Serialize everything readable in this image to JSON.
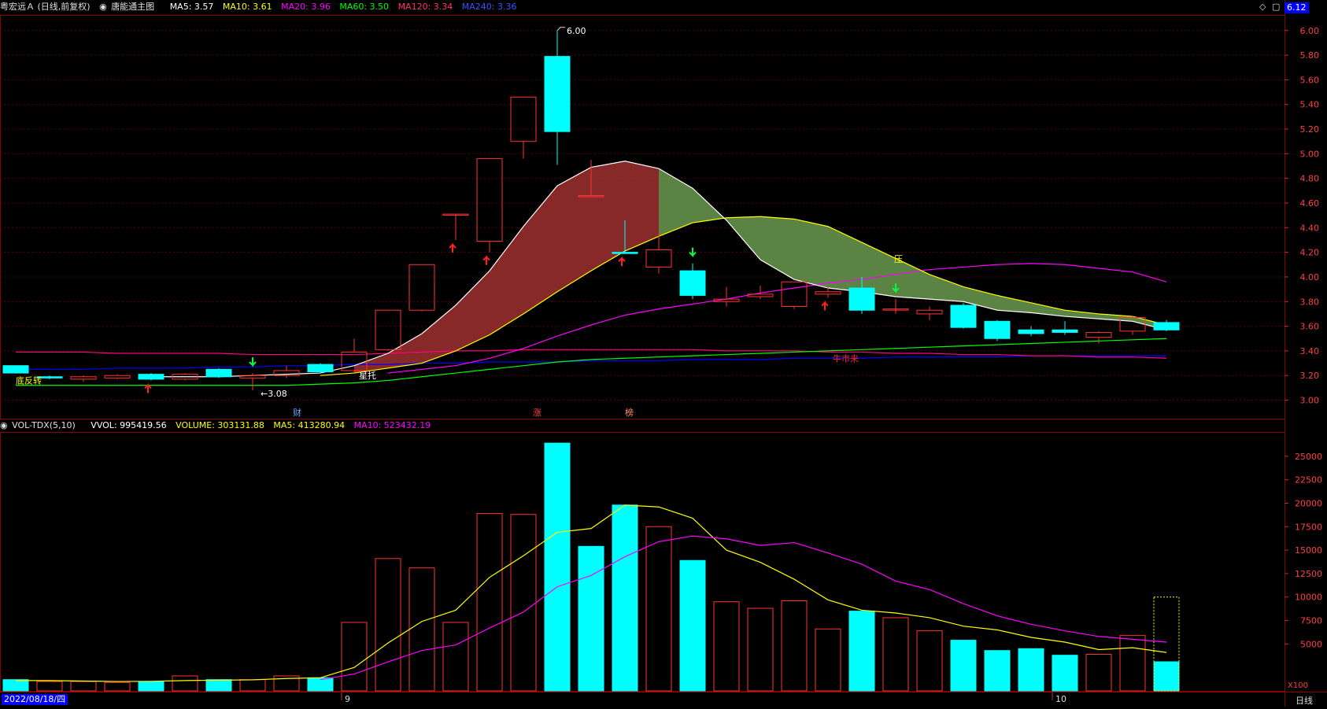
{
  "header": {
    "stock": "粤宏远Ａ (日线,前复权)",
    "indicator_name": "唐能通主图",
    "ma5": "MA5: 3.57",
    "ma10": "MA10: 3.61",
    "ma20": "MA20: 3.96",
    "ma60": "MA60: 3.50",
    "ma120": "MA120: 3.34",
    "ma240": "MA240: 3.36",
    "price_box": "6.12"
  },
  "volume_header": {
    "name": "VOL-TDX(5,10)",
    "vvol": "VVOL: 995419.56",
    "volume": "VOLUME: 303131.88",
    "ma5": "MA5: 413280.94",
    "ma10": "MA10: 523432.19"
  },
  "footer": {
    "date": "2022/08/18/四",
    "month_9": "9",
    "month_10": "10",
    "period": "日线",
    "unit": "X100"
  },
  "annotations": {
    "high_label": "6.00",
    "low_label": "←3.08",
    "xingtuo": "星托",
    "ya": "压",
    "niushi": "牛市来",
    "cai": "财",
    "zhang": "涨",
    "bang": "榜",
    "left_small": "底反转"
  },
  "colors": {
    "up": "#ff3333",
    "down": "#00ffff",
    "ma5": "#ffffff",
    "ma10": "#ffff00",
    "ma20": "#ff00ff",
    "ma60": "#00ff00",
    "ma120": "#ff0080",
    "ma240": "#0000ff",
    "bull_cloud": "#a03030",
    "bear_cloud": "#6b9b50"
  },
  "chart_data": [
    {
      "type": "candlestick",
      "title": "粤宏远Ａ (日线,前复权)",
      "ylim": [
        2.85,
        6.12
      ],
      "yticks": [
        3.0,
        3.2,
        3.4,
        3.6,
        3.8,
        4.0,
        4.2,
        4.4,
        4.6,
        4.8,
        5.0,
        5.2,
        5.4,
        5.6,
        5.8,
        6.0
      ],
      "candles": [
        {
          "o": 3.28,
          "h": 3.28,
          "l": 3.22,
          "c": 3.22
        },
        {
          "o": 3.19,
          "h": 3.2,
          "l": 3.17,
          "c": 3.18
        },
        {
          "o": 3.17,
          "h": 3.2,
          "l": 3.15,
          "c": 3.19
        },
        {
          "o": 3.18,
          "h": 3.21,
          "l": 3.17,
          "c": 3.2
        },
        {
          "o": 3.21,
          "h": 3.22,
          "l": 3.16,
          "c": 3.17
        },
        {
          "o": 3.17,
          "h": 3.22,
          "l": 3.16,
          "c": 3.21
        },
        {
          "o": 3.25,
          "h": 3.26,
          "l": 3.18,
          "c": 3.19
        },
        {
          "o": 3.18,
          "h": 3.22,
          "l": 3.08,
          "c": 3.2
        },
        {
          "o": 3.2,
          "h": 3.28,
          "l": 3.18,
          "c": 3.24
        },
        {
          "o": 3.29,
          "h": 3.3,
          "l": 3.22,
          "c": 3.23
        },
        {
          "o": 3.24,
          "h": 3.5,
          "l": 3.22,
          "c": 3.39
        },
        {
          "o": 3.41,
          "h": 3.73,
          "l": 3.4,
          "c": 3.73
        },
        {
          "o": 3.73,
          "h": 4.1,
          "l": 3.72,
          "c": 4.1
        },
        {
          "o": 4.51,
          "h": 4.51,
          "l": 4.3,
          "c": 4.51
        },
        {
          "o": 4.29,
          "h": 4.96,
          "l": 4.2,
          "c": 4.96
        },
        {
          "o": 5.1,
          "h": 5.46,
          "l": 4.96,
          "c": 5.46
        },
        {
          "o": 5.79,
          "h": 6.0,
          "l": 4.91,
          "c": 5.18
        },
        {
          "o": 4.66,
          "h": 4.95,
          "l": 4.66,
          "c": 4.66
        },
        {
          "o": 4.2,
          "h": 4.46,
          "l": 4.19,
          "c": 4.19
        },
        {
          "o": 4.08,
          "h": 4.35,
          "l": 4.03,
          "c": 4.22
        },
        {
          "o": 4.05,
          "h": 4.11,
          "l": 3.82,
          "c": 3.85
        },
        {
          "o": 3.8,
          "h": 3.92,
          "l": 3.76,
          "c": 3.82
        },
        {
          "o": 3.84,
          "h": 3.93,
          "l": 3.82,
          "c": 3.86
        },
        {
          "o": 3.76,
          "h": 3.96,
          "l": 3.74,
          "c": 3.96
        },
        {
          "o": 3.86,
          "h": 3.92,
          "l": 3.83,
          "c": 3.88
        },
        {
          "o": 3.91,
          "h": 4.0,
          "l": 3.7,
          "c": 3.73
        },
        {
          "o": 3.74,
          "h": 3.82,
          "l": 3.7,
          "c": 3.74
        },
        {
          "o": 3.7,
          "h": 3.76,
          "l": 3.65,
          "c": 3.73
        },
        {
          "o": 3.77,
          "h": 3.79,
          "l": 3.58,
          "c": 3.59
        },
        {
          "o": 3.64,
          "h": 3.65,
          "l": 3.48,
          "c": 3.5
        },
        {
          "o": 3.57,
          "h": 3.6,
          "l": 3.52,
          "c": 3.54
        },
        {
          "o": 3.57,
          "h": 3.64,
          "l": 3.53,
          "c": 3.55
        },
        {
          "o": 3.51,
          "h": 3.56,
          "l": 3.46,
          "c": 3.55
        },
        {
          "o": 3.56,
          "h": 3.68,
          "l": 3.53,
          "c": 3.67
        },
        {
          "o": 3.63,
          "h": 3.65,
          "l": 3.56,
          "c": 3.57
        }
      ],
      "ma5": [
        null,
        null,
        null,
        null,
        3.19,
        3.19,
        3.19,
        3.2,
        3.21,
        3.22,
        3.28,
        3.38,
        3.54,
        3.77,
        4.05,
        4.41,
        4.74,
        4.89,
        4.94,
        4.88,
        4.72,
        4.46,
        4.14,
        3.98,
        3.91,
        3.88,
        3.84,
        3.82,
        3.8,
        3.73,
        3.71,
        3.68,
        3.66,
        3.64,
        3.57
      ],
      "ma10": [
        null,
        null,
        null,
        null,
        null,
        null,
        null,
        null,
        null,
        3.2,
        3.22,
        3.26,
        3.3,
        3.4,
        3.53,
        3.7,
        3.88,
        4.05,
        4.21,
        4.33,
        4.44,
        4.48,
        4.49,
        4.47,
        4.41,
        4.28,
        4.15,
        4.02,
        3.92,
        3.85,
        3.79,
        3.73,
        3.7,
        3.68,
        3.61
      ],
      "ma20": [
        null,
        null,
        null,
        null,
        null,
        null,
        null,
        null,
        null,
        null,
        null,
        3.22,
        3.25,
        3.28,
        3.34,
        3.42,
        3.52,
        3.61,
        3.69,
        3.74,
        3.78,
        3.82,
        3.87,
        3.91,
        3.95,
        3.98,
        4.02,
        4.06,
        4.08,
        4.1,
        4.11,
        4.1,
        4.07,
        4.04,
        3.96
      ],
      "ma60": [
        3.12,
        3.12,
        3.12,
        3.12,
        3.12,
        3.12,
        3.12,
        3.12,
        3.12,
        3.13,
        3.14,
        3.16,
        3.19,
        3.22,
        3.25,
        3.28,
        3.31,
        3.33,
        3.34,
        3.35,
        3.36,
        3.37,
        3.38,
        3.39,
        3.4,
        3.41,
        3.42,
        3.43,
        3.44,
        3.45,
        3.46,
        3.47,
        3.48,
        3.49,
        3.5
      ],
      "ma120": [
        3.39,
        3.39,
        3.39,
        3.38,
        3.38,
        3.38,
        3.38,
        3.37,
        3.37,
        3.37,
        3.37,
        3.38,
        3.39,
        3.4,
        3.4,
        3.41,
        3.41,
        3.41,
        3.41,
        3.41,
        3.41,
        3.4,
        3.4,
        3.4,
        3.39,
        3.39,
        3.38,
        3.38,
        3.37,
        3.37,
        3.36,
        3.36,
        3.35,
        3.35,
        3.34
      ],
      "ma240": [
        3.25,
        3.25,
        3.25,
        3.26,
        3.26,
        3.26,
        3.27,
        3.27,
        3.28,
        3.28,
        3.29,
        3.29,
        3.3,
        3.3,
        3.31,
        3.31,
        3.31,
        3.32,
        3.32,
        3.32,
        3.33,
        3.33,
        3.33,
        3.34,
        3.34,
        3.34,
        3.35,
        3.35,
        3.35,
        3.35,
        3.36,
        3.36,
        3.36,
        3.36,
        3.36
      ],
      "up_arrows": [
        4,
        13,
        14,
        18,
        24
      ],
      "down_arrows": [
        7,
        20,
        26
      ]
    },
    {
      "type": "bar",
      "title": "VOL-TDX(5,10)",
      "unit": "X100",
      "ylim": [
        0,
        27500
      ],
      "yticks": [
        5000,
        7500,
        10000,
        12500,
        15000,
        17500,
        20000,
        22500,
        25000
      ],
      "values": [
        1200,
        1000,
        1000,
        900,
        1000,
        1600,
        1200,
        1200,
        1600,
        1400,
        7300,
        14100,
        13100,
        7300,
        18900,
        18800,
        26400,
        15400,
        19800,
        17500,
        13900,
        9500,
        8800,
        9600,
        6600,
        8500,
        7800,
        6400,
        5400,
        4300,
        4500,
        3800,
        3900,
        5900,
        3100
      ],
      "up": [
        false,
        true,
        true,
        true,
        false,
        true,
        false,
        true,
        true,
        false,
        true,
        true,
        true,
        true,
        true,
        true,
        false,
        false,
        false,
        true,
        false,
        true,
        true,
        true,
        true,
        false,
        true,
        true,
        false,
        false,
        false,
        false,
        true,
        true,
        false
      ],
      "ma5": [
        1100,
        1100,
        1050,
        1000,
        1020,
        1100,
        1140,
        1180,
        1320,
        1400,
        2500,
        5100,
        7400,
        8600,
        12100,
        14400,
        16900,
        17300,
        19800,
        19600,
        18400,
        15000,
        13700,
        11900,
        9700,
        8600,
        8300,
        7800,
        6900,
        6500,
        5700,
        5200,
        4400,
        4600,
        4100
      ],
      "ma10": [
        null,
        null,
        null,
        null,
        null,
        null,
        null,
        null,
        null,
        1200,
        1800,
        3100,
        4300,
        4900,
        6700,
        8400,
        11100,
        12300,
        14300,
        15900,
        16500,
        16200,
        15500,
        15800,
        14700,
        13500,
        11700,
        10800,
        9300,
        8000,
        7100,
        6400,
        5800,
        5500,
        5200
      ]
    }
  ]
}
